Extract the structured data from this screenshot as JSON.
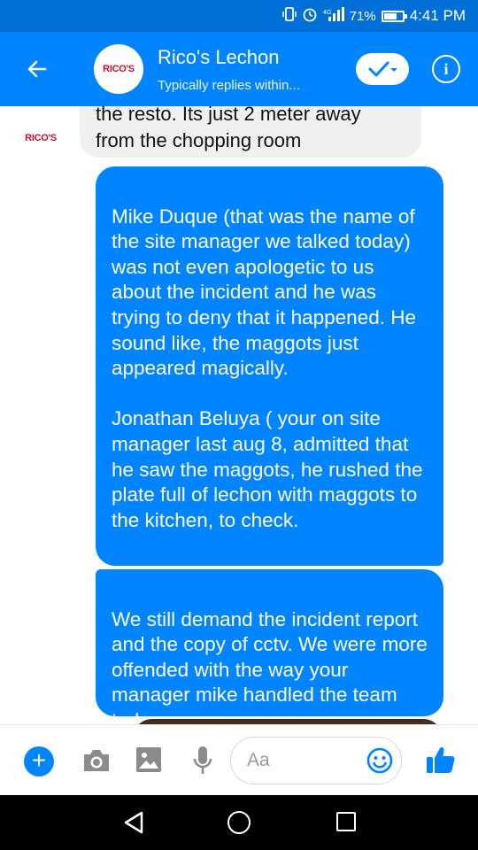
{
  "status_bar": {
    "battery": "71%",
    "time": "4:41 PM",
    "battery_level": 0.71,
    "icons": [
      "vibrate-icon",
      "alarm-icon",
      "signal-icon",
      "battery-icon"
    ]
  },
  "header": {
    "title": "Rico's Lechon",
    "subtitle": "Typically replies within...",
    "avatar_logo": "RICO'S",
    "back_icon": "arrow-left-icon",
    "verify_icon": "checkmark-dropdown-icon",
    "info_icon": "info-icon"
  },
  "messages": [
    {
      "sender": "page",
      "avatar_logo": "RICO'S",
      "text": "the resto. Its just 2 meter away\nfrom the chopping room"
    },
    {
      "sender": "me",
      "text": "Mike Duque (that was the name of the site manager we talked today) was not even apologetic to us about the incident and he was trying to deny that it happened. He sound like, the maggots just appeared magically.\n\nJonathan Beluya ( your on site manager last aug 8, admitted that he saw the maggots, he rushed the plate full of lechon with maggots to the kitchen, to check."
    },
    {
      "sender": "me",
      "text": "We still demand the incident report and the copy of cctv. We were more offended with the way your manager mike handled the team today."
    }
  ],
  "composer": {
    "placeholder": "Aa",
    "icons": [
      "plus-icon",
      "camera-icon",
      "image-icon",
      "microphone-icon",
      "emoji-icon",
      "thumbs-up-icon"
    ]
  },
  "colors": {
    "status_bar": "#0070d8",
    "header": "#0084ff",
    "outgoing_bubble": "#0084ff",
    "incoming_bubble": "#f1f0f0",
    "logo_red": "#c8102e"
  }
}
